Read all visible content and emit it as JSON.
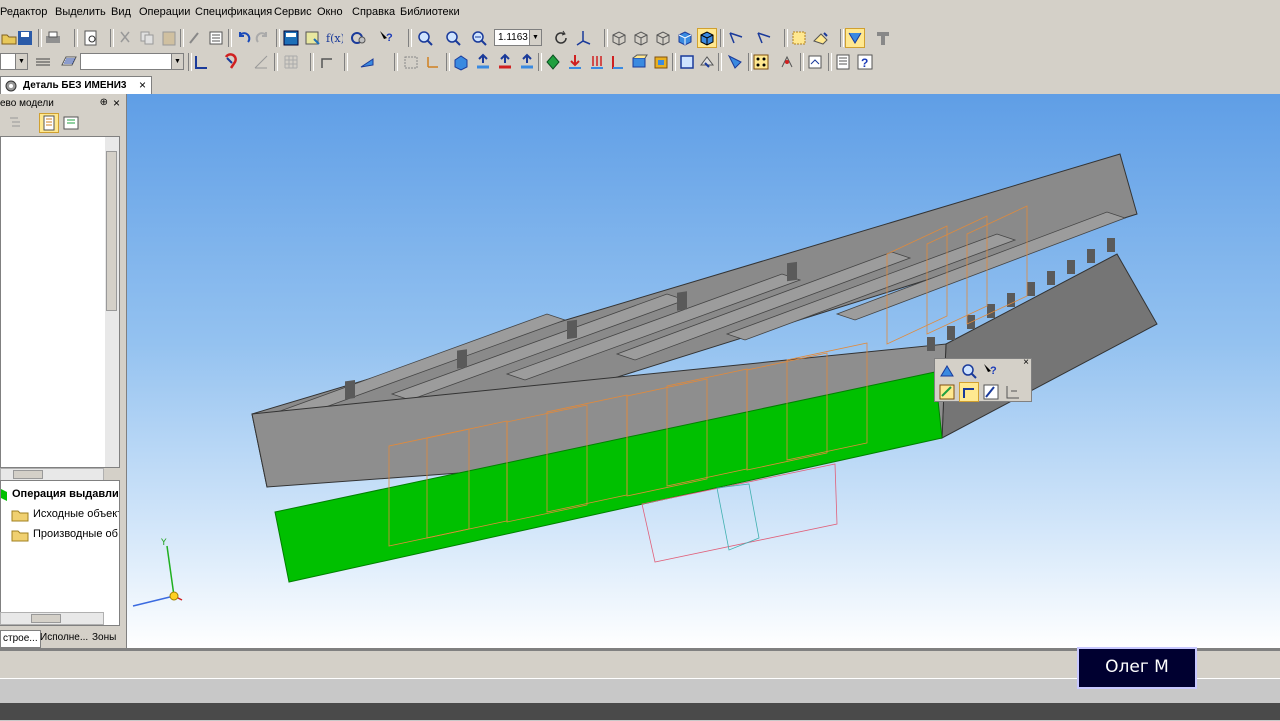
{
  "menu": [
    "Редактор",
    "Выделить",
    "Вид",
    "Операции",
    "Спецификация",
    "Сервис",
    "Окно",
    "Справка",
    "Библиотеки"
  ],
  "toolbar": {
    "zoom_value": "1.1163"
  },
  "document_tab": {
    "title": "Деталь БЕЗ ИМЕНИ3"
  },
  "left_panel": {
    "title": "ево модели",
    "tree_items": [
      {
        "label": "Операция выдавлив",
        "bold": true
      },
      {
        "label": "Исходные объект"
      },
      {
        "label": "Производные об"
      }
    ],
    "bottom_tabs": [
      "строе...",
      "Исполне...",
      "Зоны"
    ]
  },
  "axes": {
    "y_label": "Y"
  },
  "watermark": {
    "text": "Олег М"
  },
  "colors": {
    "viewport_top": "#5f9ee6",
    "selection_green": "#00c000",
    "body_gray": "#8c8c8c",
    "sketch_orange": "#e08a3c"
  }
}
